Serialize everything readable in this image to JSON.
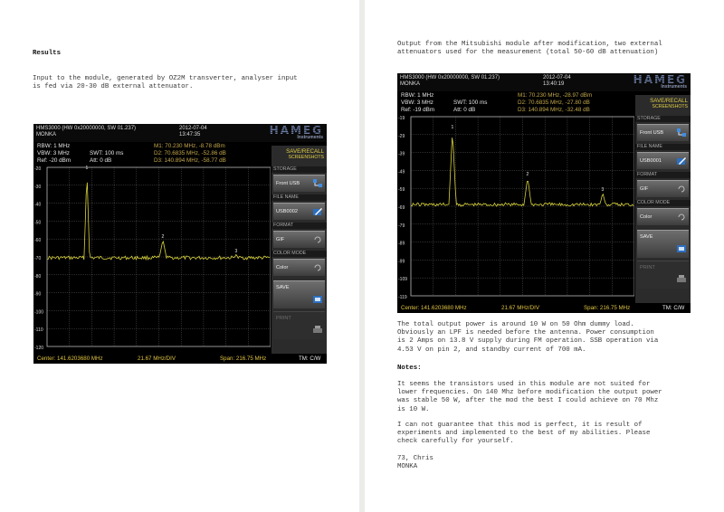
{
  "left_page": {
    "heading": "Results",
    "intro": "Input to the module, generated by OZ2M transverter, analyser input\nis fed via 20-30 dB external attenuator.",
    "screenshot": {
      "model": "HMS3000 (HW 0x20000000, SW 01.237)",
      "user": "MONKA",
      "date": "2012-07-04",
      "time": "13:47:35",
      "logo": "HAMEG",
      "logo_sub": "Instruments",
      "rbw": "RBW: 1 MHz",
      "vbw": "VBW: 3 MHz",
      "ref": "Ref: -20 dBm",
      "swt": "SWT: 100 ms",
      "att": "Att: 0 dB",
      "m1": "M1: 70.230 MHz, -8.78 dBm",
      "d2": "D2: 70.6835 MHz, -52.86 dB",
      "d3": "D3: 140.894 MHz, -58.77 dB",
      "menu_title_1": "SAVE/RECALL",
      "menu_title_2": "SCREENSHOTS",
      "storage_label": "STORAGE",
      "storage_value": "Front USB",
      "filename_label": "FILE NAME",
      "filename_value": "USB0002",
      "format_label": "FORMAT",
      "format_value": "GIF",
      "colormode_label": "COLOR MODE",
      "colormode_value": "Color",
      "save_label": "SAVE",
      "print_label": "PRINT",
      "center": "Center: 141.6203680 MHz",
      "div": "21.67 MHz/DIV",
      "span": "Span: 216.75 MHz",
      "tm": "TM: C/W",
      "y_ticks": [
        "-20",
        "-30",
        "-40",
        "-50",
        "-60",
        "-70",
        "-80",
        "-90",
        "-100",
        "-110",
        "-120"
      ],
      "marker_labels": [
        "1",
        "2",
        "3"
      ]
    }
  },
  "right_page": {
    "intro": "Output from the Mitsubishi module after modification, two external\nattenuators used for the measurement (total 50-60 dB attenuation)",
    "screenshot": {
      "model": "HMS3000 (HW 0x20000000, SW 01.237)",
      "user": "MONKA",
      "date": "2012-07-04",
      "time": "13:40:19",
      "logo": "HAMEG",
      "logo_sub": "Instruments",
      "rbw": "RBW: 1 MHz",
      "vbw": "VBW: 3 MHz",
      "ref": "Ref: -19 dBm",
      "swt": "SWT: 100 ms",
      "att": "Att: 0 dB",
      "m1": "M1: 70.230 MHz, -28.97 dBm",
      "d2": "D2: 70.6835 MHz, -27.80 dB",
      "d3": "D3: 140.894 MHz, -32.48 dB",
      "menu_title_1": "SAVE/RECALL",
      "menu_title_2": "SCREENSHOTS",
      "storage_label": "STORAGE",
      "storage_value": "Front USB",
      "filename_label": "FILE NAME",
      "filename_value": "USB0001",
      "format_label": "FORMAT",
      "format_value": "GIF",
      "colormode_label": "COLOR MODE",
      "colormode_value": "Color",
      "save_label": "SAVE",
      "print_label": "PRINT",
      "center": "Center: 141.6203680 MHz",
      "div": "21.67 MHz/DIV",
      "span": "Span: 216.75 MHz",
      "tm": "TM: C/W",
      "y_ticks": [
        "-19",
        "-29",
        "-39",
        "-49",
        "-59",
        "-69",
        "-79",
        "-89",
        "-99",
        "-109",
        "-119"
      ],
      "marker_labels": [
        "1",
        "2",
        "3"
      ]
    },
    "para1": "The total output power is around 10 W on 50 Ohm dummy load.\nObviously an LPF is needed before the antenna. Power consumption\nis 2 Amps on 13.8 V supply during FM operation. SSB operation via\n4.53 V on pin 2, and standby current of 700 mA.",
    "notes_heading": "Notes:",
    "para2": "It seems the transistors used in this module are not suited for\nlower frequencies. On 140 Mhz before modification the output power\nwas stable 50 W, after the mod the best I could achieve on 70 Mhz\nis 10 W.",
    "para3": "I can not guarantee that this mod is perfect, it is result of\nexperiments and implemented to the best of my abilities. Please\ncheck carefully for yourself.",
    "signoff": "73, Chris\nMONKA"
  },
  "colors": {
    "trace": "#d8d23c",
    "marker": "#e8e8e8",
    "grid": "#9a9a9a",
    "accent": "#e2cf44"
  }
}
